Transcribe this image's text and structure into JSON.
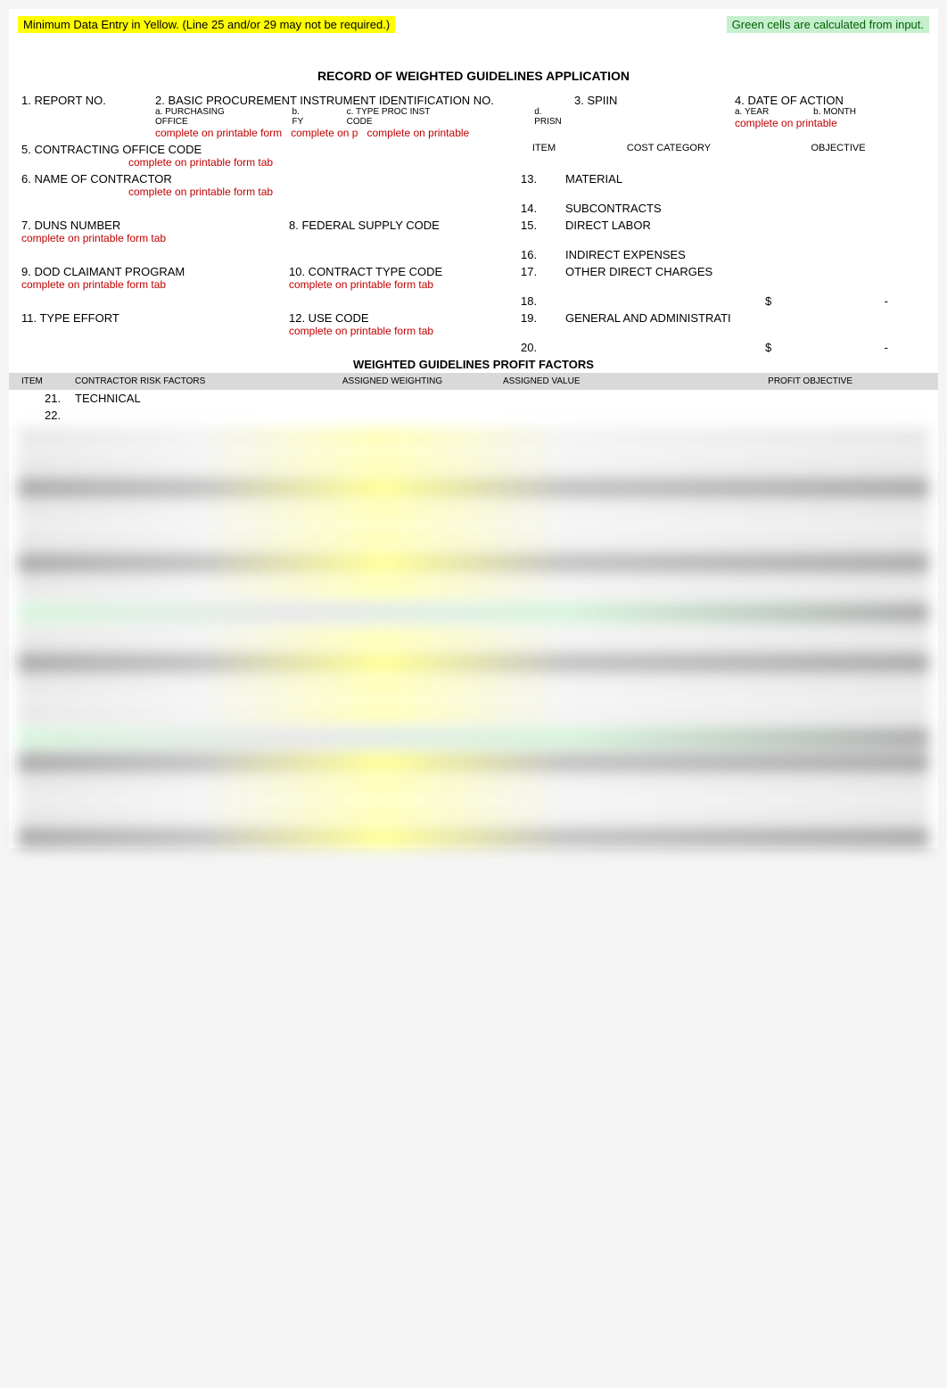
{
  "legend": {
    "yellow": "Minimum Data Entry in Yellow. (Line 25 and/or 29 may not be required.)",
    "green": "Green cells are calculated from input."
  },
  "form_title": "RECORD OF WEIGHTED GUIDELINES APPLICATION",
  "fields": {
    "report_no": "1. REPORT NO.",
    "basic_procurement": "2. BASIC PROCUREMENT INSTRUMENT IDENTIFICATION NO.",
    "purchasing_office": "a. PURCHASING OFFICE",
    "fy": "b. FY",
    "type_proc": "c. TYPE PROC INST CODE",
    "prisn": "d. PRISN",
    "spiin": "3. SPIIN",
    "date_of_action": "4. DATE OF ACTION",
    "year": "a. YEAR",
    "month": "b. MONTH",
    "contracting_office": "5. CONTRACTING OFFICE CODE",
    "contractor_name": "6. NAME OF CONTRACTOR",
    "duns": "7. DUNS NUMBER",
    "federal_supply": "8. FEDERAL SUPPLY CODE",
    "dod_claimant": "9. DOD CLAIMANT PROGRAM",
    "contract_type_code": "10. CONTRACT TYPE CODE",
    "type_effort": "11. TYPE EFFORT",
    "use_code": "12. USE CODE"
  },
  "notes": {
    "complete_printable": "complete on printable form tab",
    "complete_p": "complete on p",
    "complete_on_printable": "complete on printable"
  },
  "cost_table": {
    "item_hdr": "ITEM",
    "category_hdr": "COST CATEGORY",
    "objective_hdr": "OBJECTIVE",
    "rows": [
      {
        "num": "13.",
        "label": "MATERIAL"
      },
      {
        "num": "14.",
        "label": "SUBCONTRACTS"
      },
      {
        "num": "15.",
        "label": "DIRECT LABOR"
      },
      {
        "num": "16.",
        "label": "INDIRECT EXPENSES"
      },
      {
        "num": "17.",
        "label": "OTHER DIRECT CHARGES"
      },
      {
        "num": "18.",
        "label": ""
      },
      {
        "num": "19.",
        "label": "GENERAL AND ADMINISTRATI"
      },
      {
        "num": "20.",
        "label": ""
      }
    ]
  },
  "profit_section": {
    "title": "WEIGHTED GUIDELINES PROFIT FACTORS",
    "headers": {
      "item": "ITEM",
      "risk_factors": "CONTRACTOR RISK FACTORS",
      "assigned_weighting": "ASSIGNED WEIGHTING",
      "assigned_value": "ASSIGNED VALUE",
      "profit_objective": "PROFIT OBJECTIVE"
    },
    "rows": [
      {
        "num": "21.",
        "label": "TECHNICAL"
      },
      {
        "num": "22.",
        "label": ""
      }
    ]
  },
  "dollar": "$",
  "dash": "-"
}
